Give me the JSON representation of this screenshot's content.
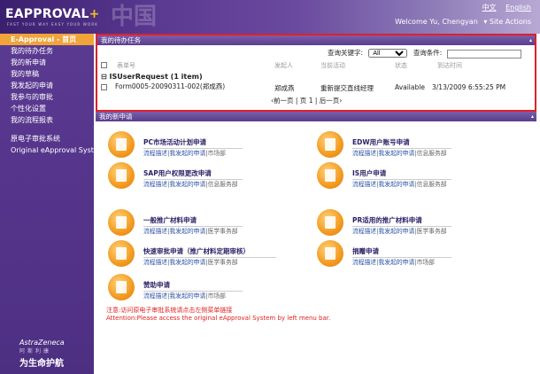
{
  "header": {
    "logo_text": "EAPPROVAL",
    "logo_plus": "+",
    "tagline": "FAST YOUR WAY EASY YOUR WORK",
    "languages": [
      "中文",
      "English"
    ],
    "welcome": "Welcome Yu, Chengyan",
    "site_actions": "Site Actions"
  },
  "sidebar": {
    "items": [
      {
        "label": "E-Approval - 首页",
        "active": true
      },
      {
        "label": "我的待办任务"
      },
      {
        "label": "我的新申请"
      },
      {
        "label": "我的草稿"
      },
      {
        "label": "我发起的申请"
      },
      {
        "label": "我参与的审批"
      },
      {
        "label": "个性化设置"
      },
      {
        "label": "我的流程报表"
      }
    ],
    "extra_items": [
      {
        "label": "原电子审批系统"
      },
      {
        "label": "Original eApproval System"
      }
    ],
    "brand": {
      "name": "AstraZeneca",
      "cn": "阿斯利康",
      "slogan": "为生命护航"
    }
  },
  "tasks": {
    "title": "我的待办任务",
    "query_keyword_label": "查询关键字:",
    "query_keyword_value": "All",
    "query_condition_label": "查询条件:",
    "query_condition_value": "",
    "columns": [
      "表单号",
      "发起人",
      "当前活动",
      "状态",
      "到达时间"
    ],
    "group": "ISUserRequest (1 item)",
    "rows": [
      {
        "form": "Form0005-20090311-002(郑成燕)",
        "initiator": "郑成燕",
        "activity": "重新提交直线经理",
        "status": "Available",
        "time": "3/13/2009 6:55:25 PM"
      }
    ],
    "pager": {
      "prev": "前一页",
      "page_label": "页",
      "page": "1",
      "next": "后一页"
    }
  },
  "new_requests": {
    "title": "我的新申请",
    "items": [
      {
        "title": "PC市场活动计划申请",
        "links": [
          "流程描述",
          "我发起的申请"
        ],
        "dept": "市场部"
      },
      {
        "title": "EDW用户账号申请",
        "links": [
          "流程描述",
          "我发起的申请"
        ],
        "dept": "信息服务部"
      },
      {
        "title": "SAP用户权限更改申请",
        "links": [
          "流程描述",
          "我发起的申请"
        ],
        "dept": "信息服务部"
      },
      {
        "title": "IS用户申请",
        "links": [
          "流程描述",
          "我发起的申请"
        ],
        "dept": "信息服务部"
      },
      {
        "title": "一般推广材料申请",
        "links": [
          "流程描述",
          "我发起的申请"
        ],
        "dept": "医学事务部"
      },
      {
        "title": "PR适用的推广材料申请",
        "links": [
          "流程描述",
          "我发起的申请"
        ],
        "dept": "医学事务部"
      },
      {
        "title": "快速审批申请（推广材料定期审核）",
        "links": [
          "流程描述",
          "我发起的申请"
        ],
        "dept": "医学事务部"
      },
      {
        "title": "捐赠申请",
        "links": [
          "流程描述",
          "我发起的申请"
        ],
        "dept": "市场部"
      },
      {
        "title": "赞助申请",
        "links": [
          "流程描述",
          "我发起的申请"
        ],
        "dept": "市场部"
      }
    ],
    "notice_line1": "注意:访问原电子审批系统请点击左侧菜单链接",
    "notice_line2": "Attention:Please access the original eApproval System by left menu bar."
  }
}
